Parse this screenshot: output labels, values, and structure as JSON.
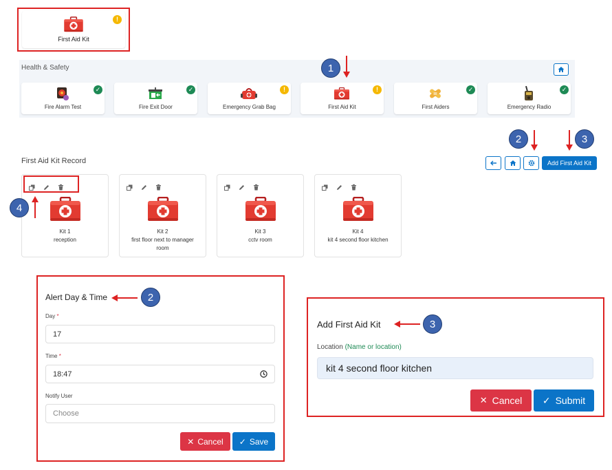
{
  "top_card": {
    "label": "First Aid Kit"
  },
  "health_safety": {
    "title": "Health & Safety",
    "items": [
      {
        "label": "Fire Alarm Test",
        "status": "ok",
        "icon": "fire-alarm-icon"
      },
      {
        "label": "Fire Exit Door",
        "status": "ok",
        "icon": "fire-exit-icon"
      },
      {
        "label": "Emergency Grab Bag",
        "status": "warn",
        "icon": "grab-bag-icon"
      },
      {
        "label": "First Aid Kit",
        "status": "warn",
        "icon": "first-aid-icon"
      },
      {
        "label": "First Aiders",
        "status": "ok",
        "icon": "bandage-icon"
      },
      {
        "label": "Emergency Radio",
        "status": "ok",
        "icon": "radio-icon"
      }
    ]
  },
  "annotations": {
    "n1": "1",
    "n2": "2",
    "n3": "3",
    "n4": "4"
  },
  "record": {
    "title": "First Aid Kit Record",
    "add_button": "Add First Aid Kit",
    "kits": [
      {
        "name": "Kit 1",
        "location": "reception"
      },
      {
        "name": "Kit 2",
        "location": "first floor next to manager room"
      },
      {
        "name": "Kit 3",
        "location": "cctv room"
      },
      {
        "name": "Kit 4",
        "location": "kit 4 second floor kitchen"
      }
    ]
  },
  "alert_form": {
    "title": "Alert Day & Time",
    "day_label": "Day",
    "day_value": "17",
    "time_label": "Time",
    "time_value": "18:47",
    "notify_label": "Notify User",
    "notify_placeholder": "Choose",
    "cancel": "Cancel",
    "save": "Save"
  },
  "add_form": {
    "title": "Add First Aid Kit",
    "location_label": "Location",
    "location_hint": "(Name or location)",
    "location_value": "kit 4 second floor kitchen",
    "cancel": "Cancel",
    "submit": "Submit"
  },
  "colors": {
    "primary": "#0b74c8",
    "danger": "#dc3545",
    "warn": "#f5b800",
    "ok": "#1e8a55",
    "annotation": "#d22"
  }
}
